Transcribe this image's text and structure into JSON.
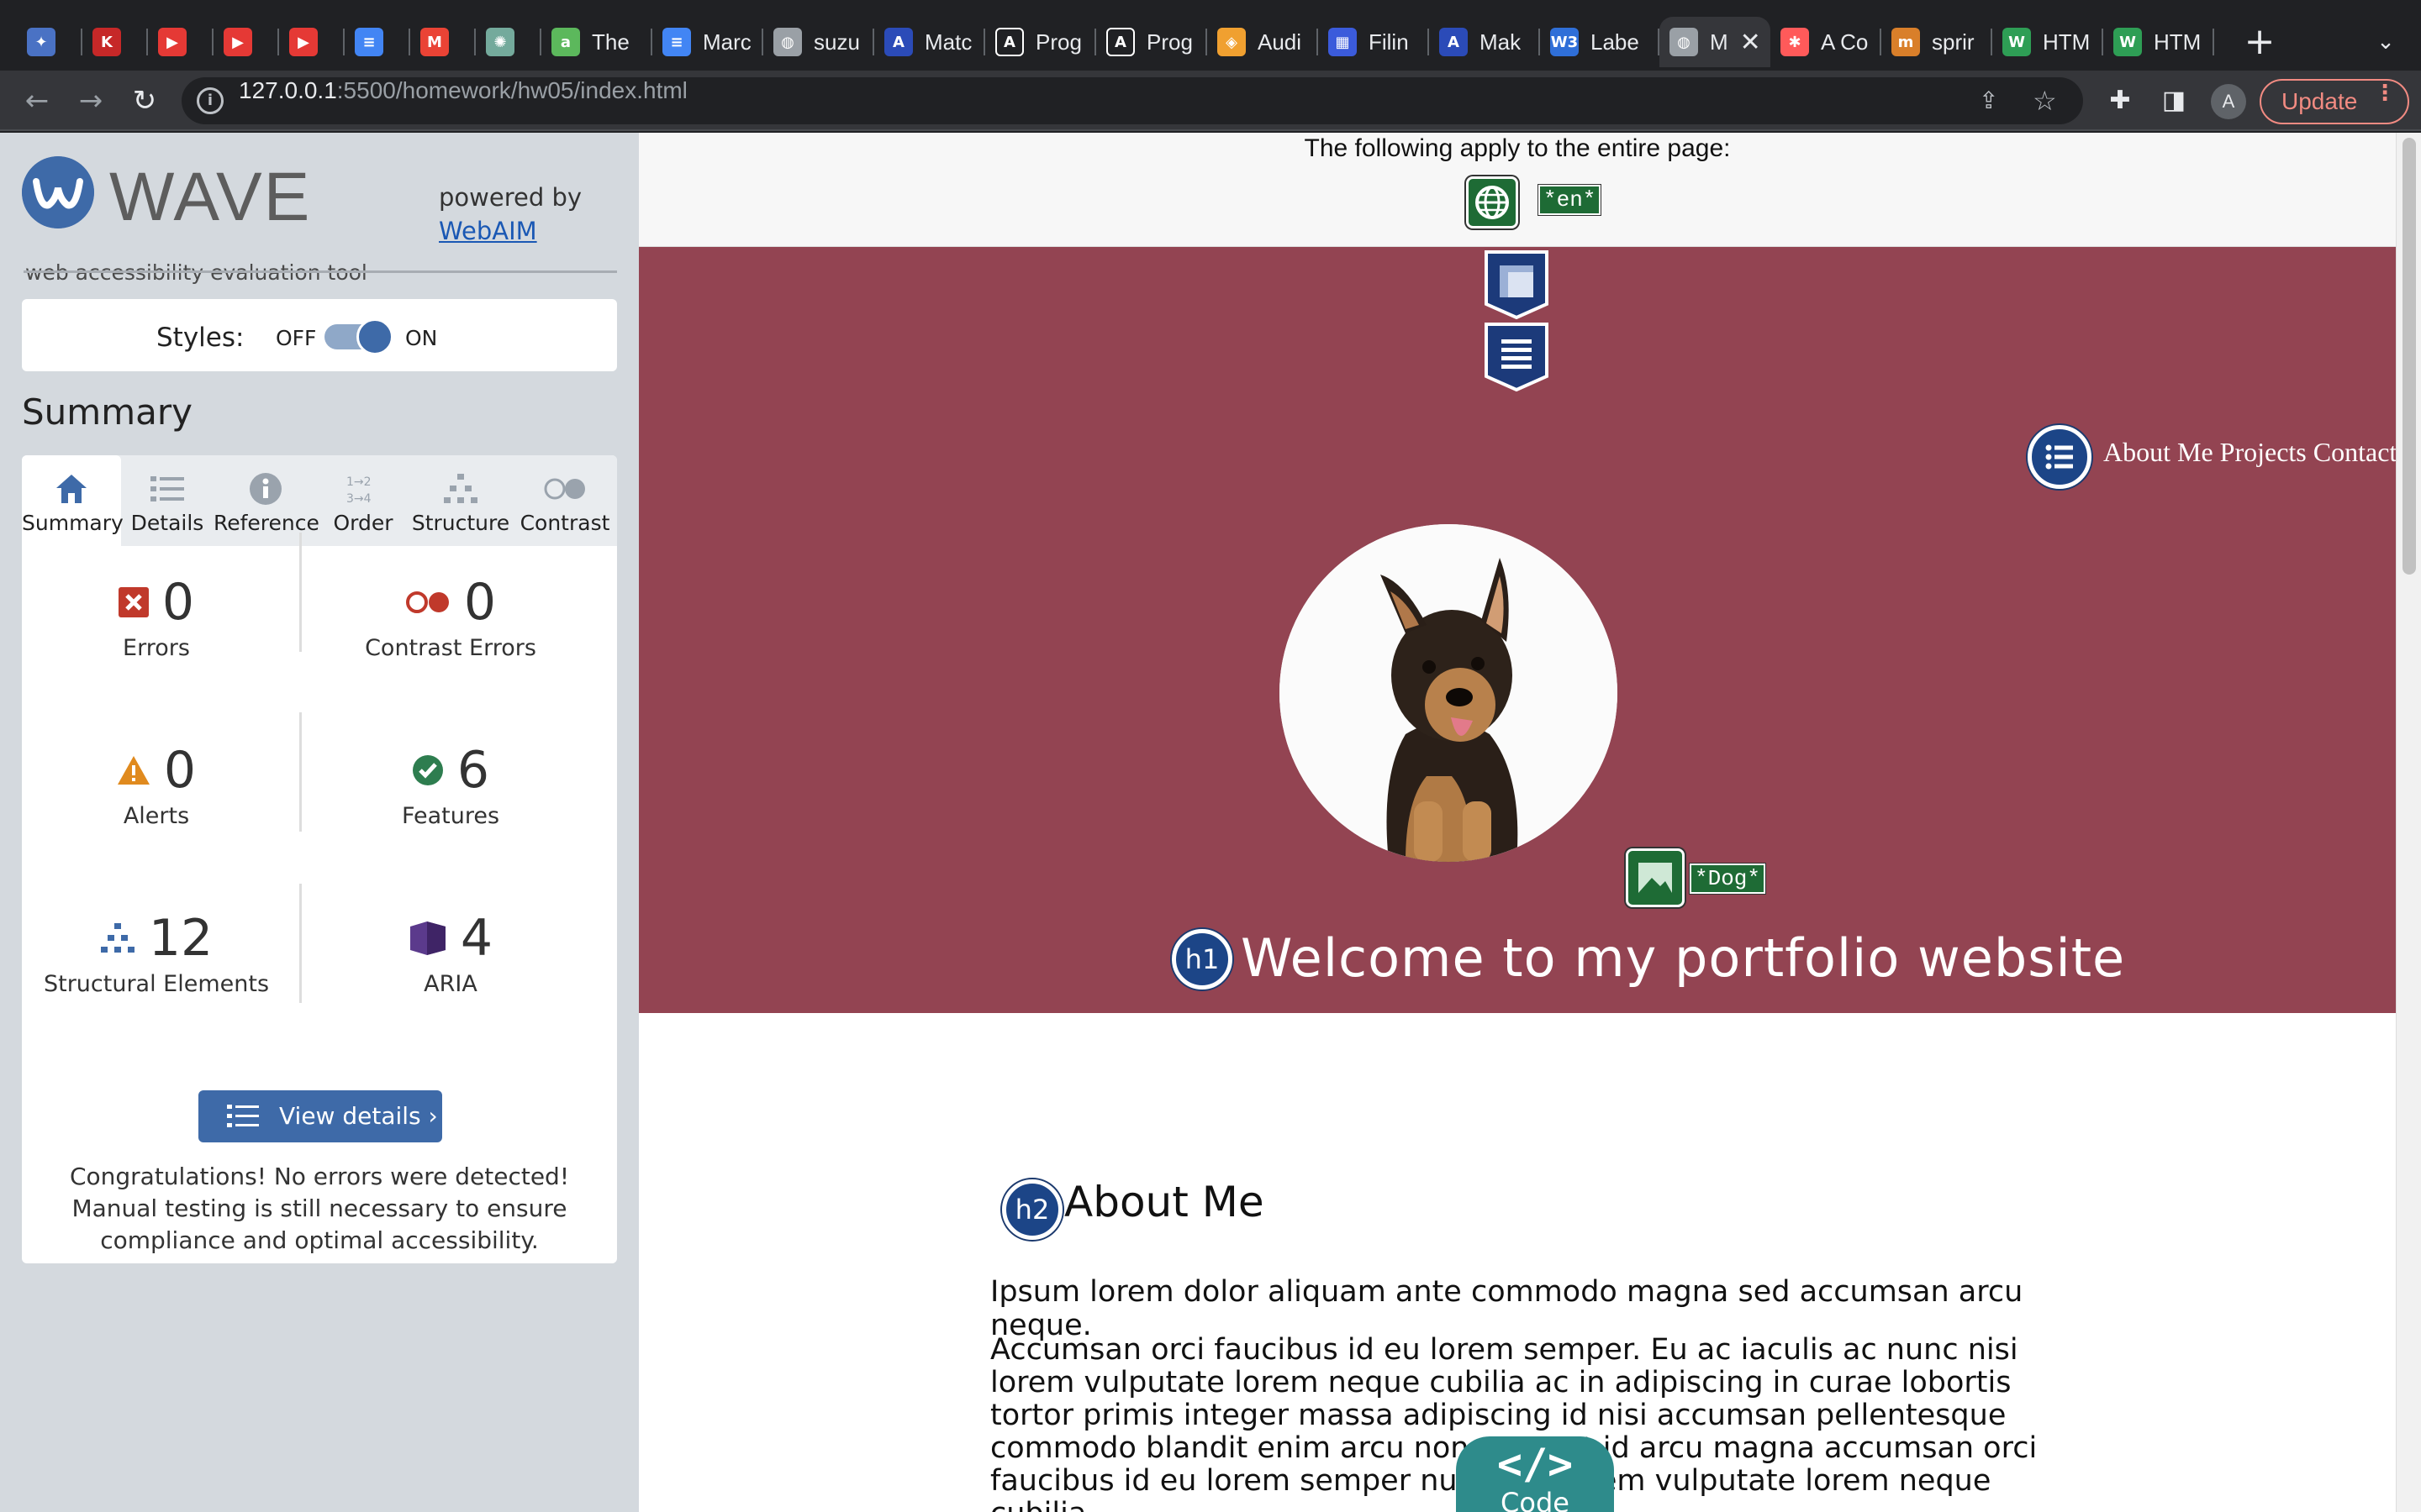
{
  "browser": {
    "tabs": [
      {
        "label": "",
        "color": "#4a72c4",
        "glyph": "✦"
      },
      {
        "label": "",
        "color": "#c62828",
        "glyph": "K"
      },
      {
        "label": "",
        "color": "#e53935",
        "glyph": "▶"
      },
      {
        "label": "",
        "color": "#e53935",
        "glyph": "▶"
      },
      {
        "label": "",
        "color": "#e53935",
        "glyph": "▶"
      },
      {
        "label": "",
        "color": "#4285f4",
        "glyph": "≡"
      },
      {
        "label": "",
        "color": "#ea4335",
        "glyph": "M"
      },
      {
        "label": "",
        "color": "#74aa9c",
        "glyph": "✺"
      },
      {
        "label": "The",
        "color": "#5cb85c",
        "glyph": "a"
      },
      {
        "label": "Marc",
        "color": "#4285f4",
        "glyph": "≡"
      },
      {
        "label": "suzu",
        "color": "#9aa0a6",
        "glyph": "◍"
      },
      {
        "label": "Matc",
        "color": "#2b4bb8",
        "glyph": "A"
      },
      {
        "label": "Prog",
        "color": "#ffffff",
        "glyph": "A"
      },
      {
        "label": "Prog",
        "color": "#ffffff",
        "glyph": "A"
      },
      {
        "label": "Audi",
        "color": "#f0a030",
        "glyph": "◈"
      },
      {
        "label": "Filin",
        "color": "#3b5bdb",
        "glyph": "▦"
      },
      {
        "label": "Mak",
        "color": "#2b4bb8",
        "glyph": "A"
      },
      {
        "label": "Labe",
        "color": "#2f6fd8",
        "glyph": "W3"
      },
      {
        "label": "M",
        "color": "#9aa0a6",
        "glyph": "◍",
        "active": true
      },
      {
        "label": "A Co",
        "color": "#ff5a5a",
        "glyph": "✱"
      },
      {
        "label": "sprir",
        "color": "#d97f2a",
        "glyph": "m"
      },
      {
        "label": "HTM",
        "color": "#2e9e55",
        "glyph": "W"
      },
      {
        "label": "HTM",
        "color": "#2e9e55",
        "glyph": "W"
      }
    ],
    "close_glyph": "✕",
    "new_tab": "+",
    "tab_menu": "⌄",
    "url_host": "127.0.0.1",
    "url_rest": ":5500/homework/hw05/index.html",
    "avatar": "A",
    "update_label": "Update"
  },
  "wave": {
    "name": "WAVE",
    "tagline": "web accessibility evaluation tool",
    "powered_by": "powered by",
    "powered_link": "WebAIM",
    "styles_label": "Styles:",
    "off": "OFF",
    "on": "ON",
    "summary_heading": "Summary",
    "tabs": [
      "Summary",
      "Details",
      "Reference",
      "Order",
      "Structure",
      "Contrast"
    ],
    "stats": {
      "errors": {
        "value": "0",
        "label": "Errors"
      },
      "contrast": {
        "value": "0",
        "label": "Contrast Errors"
      },
      "alerts": {
        "value": "0",
        "label": "Alerts"
      },
      "features": {
        "value": "6",
        "label": "Features"
      },
      "structure": {
        "value": "12",
        "label": "Structural Elements"
      },
      "aria": {
        "value": "4",
        "label": "ARIA"
      }
    },
    "view_details": "View details ›",
    "message": "Congratulations! No errors were detected! Manual testing is still necessary to ensure compliance and optimal accessibility.",
    "colors": {
      "accent": "#3e6aa8",
      "error": "#c0392b",
      "alert": "#e08a1e",
      "feature": "#2e7d4f",
      "aria": "#5b3a8c"
    }
  },
  "page": {
    "applies_text": "The following apply to the entire page:",
    "lang_label": "*en*",
    "nav_links": "About Me Projects Contact",
    "alt_label": "*Dog*",
    "h1_badge": "h1",
    "h1": "Welcome to my portfolio website",
    "h2_badge": "h2",
    "h2": "About Me",
    "p1": "Ipsum lorem dolor aliquam ante commodo magna sed accumsan arcu neque.",
    "p2": "Accumsan orci faucibus id eu lorem semper. Eu ac iaculis ac nunc nisi lorem vulputate lorem neque cubilia ac in adipiscing in curae lobortis tortor primis integer massa adipiscing id nisi accumsan pellentesque commodo blandit enim arcu non at amet id arcu magna accumsan orci faucibus id eu lorem semper nunc nisi lorem vulputate lorem neque cubilia.",
    "code_symbol": "</>",
    "code_label": "Code",
    "hero_color": "#934452"
  }
}
